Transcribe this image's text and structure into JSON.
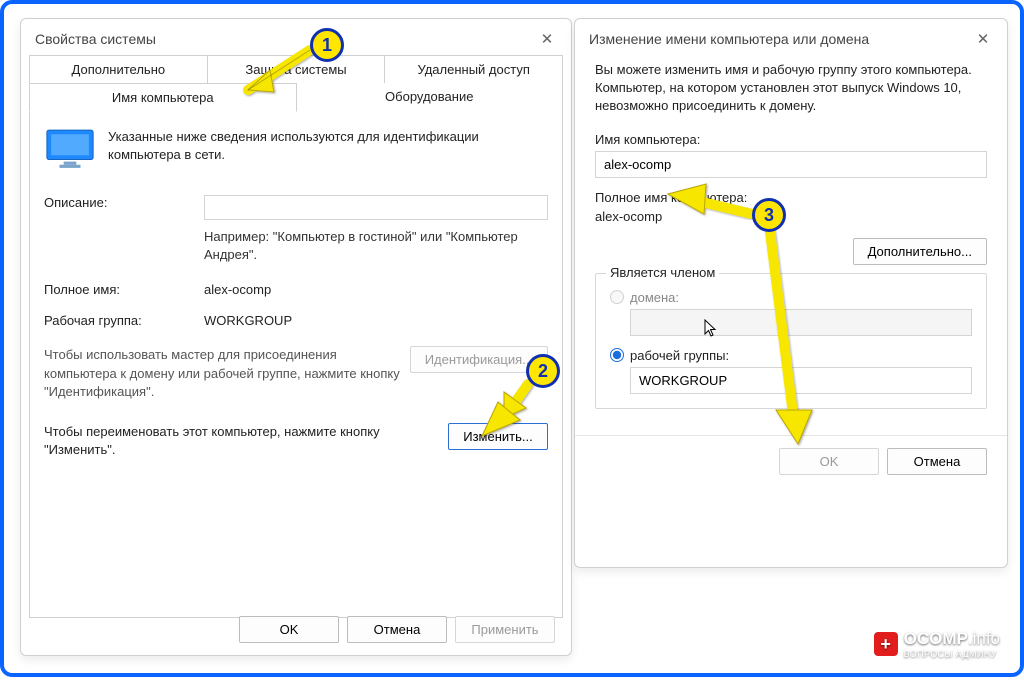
{
  "d1": {
    "title": "Свойства системы",
    "tabsTop": [
      "Дополнительно",
      "Защита системы",
      "Удаленный доступ"
    ],
    "tabsBottom": [
      "Имя компьютера",
      "Оборудование"
    ],
    "activeTab": "Имя компьютера",
    "intro": "Указанные ниже сведения используются для идентификации компьютера в сети.",
    "descLabel": "Описание:",
    "descValue": "",
    "descHint": "Например: \"Компьютер в гостиной\" или \"Компьютер Андрея\".",
    "fullNameLabel": "Полное имя:",
    "fullNameValue": "alex-ocomp",
    "workgroupLabel": "Рабочая группа:",
    "workgroupValue": "WORKGROUP",
    "idText": "Чтобы использовать мастер для присоединения компьютера к домену или рабочей группе, нажмите кнопку \"Идентификация\".",
    "idBtn": "Идентификация...",
    "changeText": "Чтобы переименовать этот компьютер, нажмите кнопку \"Изменить\".",
    "changeBtn": "Изменить...",
    "ok": "OK",
    "cancel": "Отмена",
    "apply": "Применить"
  },
  "d2": {
    "title": "Изменение имени компьютера или домена",
    "para": "Вы можете изменить имя и рабочую группу этого компьютера. Компьютер, на котором установлен этот выпуск Windows 10, невозможно присоединить к домену.",
    "nameLabel": "Имя компьютера:",
    "nameValue": "alex-ocomp",
    "fullLabel": "Полное имя компьютера:",
    "fullValue": "alex-ocomp",
    "moreBtn": "Дополнительно...",
    "memberLegend": "Является членом",
    "domainLabel": "домена:",
    "domainValue": "",
    "workgroupLabel": "рабочей группы:",
    "workgroupValue": "WORKGROUP",
    "ok": "OK",
    "cancel": "Отмена"
  },
  "badges": {
    "b1": "1",
    "b2": "2",
    "b3": "3"
  },
  "watermark": {
    "brand": "OCOMP",
    "suffix": ".info",
    "sub": "ВОПРОСЫ АДМИНУ"
  }
}
